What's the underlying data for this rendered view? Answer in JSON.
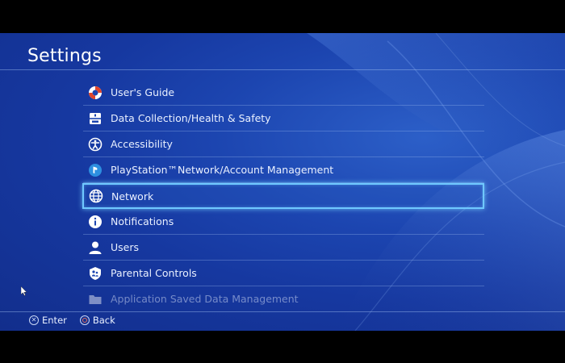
{
  "header": {
    "title": "Settings"
  },
  "menu": {
    "items": [
      {
        "label": "User's Guide",
        "icon": "lifebuoy-icon"
      },
      {
        "label": "Data Collection/Health & Safety",
        "icon": "safety-switch-icon"
      },
      {
        "label": "Accessibility",
        "icon": "accessibility-icon"
      },
      {
        "label": "PlayStation™Network/Account Management",
        "icon": "psn-icon"
      },
      {
        "label": "Network",
        "icon": "globe-icon",
        "selected": true
      },
      {
        "label": "Notifications",
        "icon": "info-icon"
      },
      {
        "label": "Users",
        "icon": "user-icon"
      },
      {
        "label": "Parental Controls",
        "icon": "family-shield-icon"
      },
      {
        "label": "Application Saved Data Management",
        "icon": "folder-icon"
      }
    ]
  },
  "footer": {
    "enter_label": "Enter",
    "back_label": "Back"
  },
  "colors": {
    "background": "#1c45b0",
    "selection_border": "#6fc8ff",
    "text": "#e9f0ff"
  }
}
